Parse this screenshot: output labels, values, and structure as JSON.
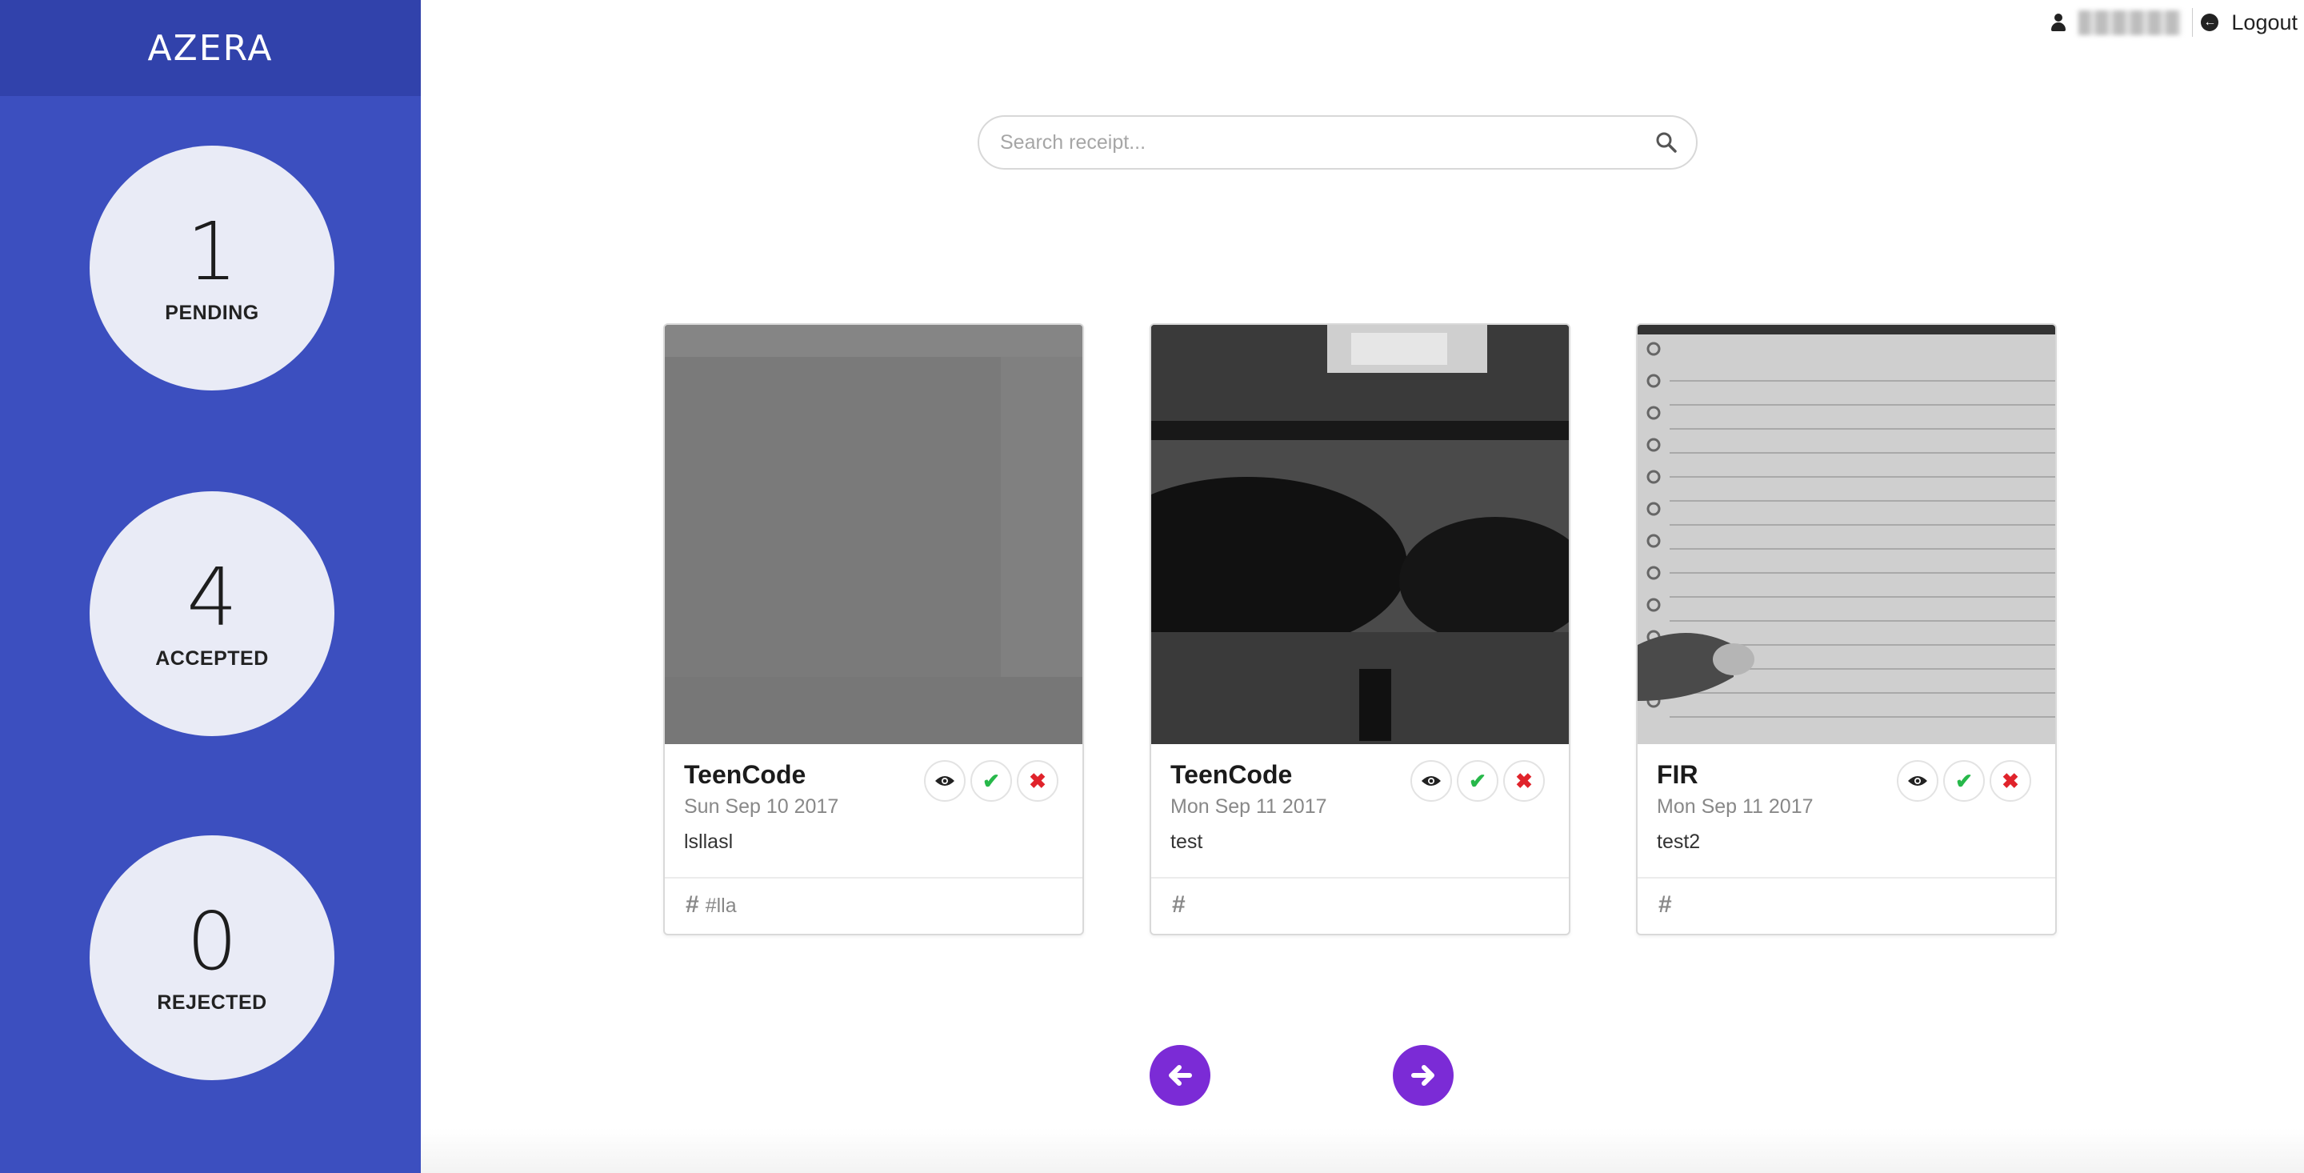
{
  "app": {
    "brand": "AZERA"
  },
  "stats": [
    {
      "value": "1",
      "label": "PENDING"
    },
    {
      "value": "4",
      "label": "ACCEPTED"
    },
    {
      "value": "0",
      "label": "REJECTED"
    }
  ],
  "topbar": {
    "username": "                ",
    "logout_label": "Logout"
  },
  "search": {
    "placeholder": "Search receipt..."
  },
  "cards": [
    {
      "title": "TeenCode",
      "date": "Sun Sep 10 2017",
      "description": "lsllasl",
      "tag": "#lla"
    },
    {
      "title": "TeenCode",
      "date": "Mon Sep 11 2017",
      "description": "test",
      "tag": ""
    },
    {
      "title": "FIR",
      "date": "Mon Sep 11 2017",
      "description": "test2",
      "tag": ""
    }
  ],
  "icons": {
    "view": "eye-icon",
    "accept": "check-icon",
    "reject": "x-icon",
    "prev": "arrow-left-icon",
    "next": "arrow-right-icon",
    "search": "search-icon",
    "user": "user-icon",
    "logout": "logout-icon"
  },
  "colors": {
    "sidebar": "#3c4fbf",
    "brand_bar": "#3142ab",
    "nav_button": "#7b2bd6",
    "accept": "#27b84a",
    "reject": "#e0232b"
  }
}
